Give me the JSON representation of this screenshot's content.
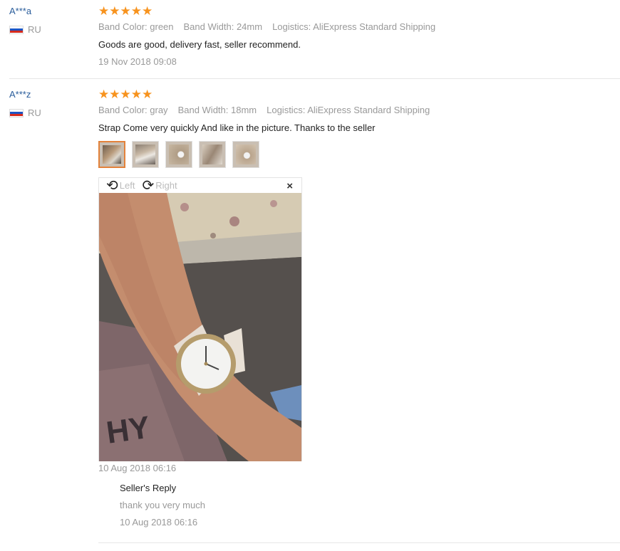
{
  "reviews": [
    {
      "user": "A***a",
      "country": "RU",
      "stars": "★★★★★",
      "attrs": [
        "Band Color: green",
        "Band Width: 24mm",
        "Logistics: AliExpress Standard Shipping"
      ],
      "text": "Goods are good, delivery fast, seller recommend.",
      "date": "19 Nov 2018 09:08"
    },
    {
      "user": "A***z",
      "country": "RU",
      "stars": "★★★★★",
      "attrs": [
        "Band Color: gray",
        "Band Width: 18mm",
        "Logistics: AliExpress Standard Shipping"
      ],
      "text": "Strap Come very quickly And like in the picture. Thanks to the seller",
      "date": "10 Aug 2018 06:16",
      "reply": {
        "title": "Seller's Reply",
        "text": "thank you very much",
        "date": "10 Aug 2018 06:16"
      }
    }
  ],
  "viewer": {
    "rotate_left": "Left",
    "rotate_right": "Right",
    "close": "×"
  },
  "colors": {
    "accent": "#f7931e",
    "link": "#2a5d9b",
    "muted": "#999999",
    "thumb_active": "#e3823b"
  }
}
